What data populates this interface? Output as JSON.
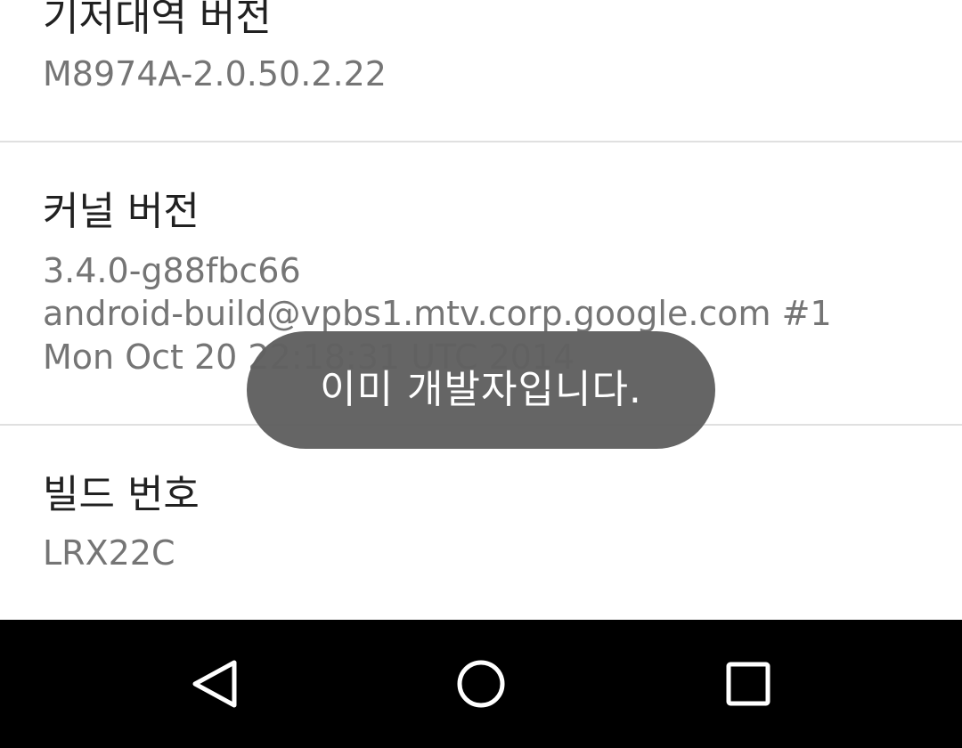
{
  "settings": {
    "baseband": {
      "title": "기저대역 버전",
      "summary": "M8974A-2.0.50.2.22"
    },
    "kernel": {
      "title": "커널 버전",
      "summary_lines": [
        "3.4.0-g88fbc66",
        "android-build@vpbs1.mtv.corp.google.com #1",
        "Mon Oct 20 22:18:31 UTC 2014"
      ]
    },
    "build": {
      "title": "빌드 번호",
      "summary": "LRX22C"
    }
  },
  "toast": {
    "message": "이미 개발자입니다."
  },
  "navigation": {
    "buttons": [
      {
        "icon": "back-triangle-icon"
      },
      {
        "icon": "home-circle-icon"
      },
      {
        "icon": "recents-square-icon"
      }
    ]
  },
  "colors": {
    "title_text": "#212121",
    "summary_text": "#757575",
    "divider": "#e0e0e0",
    "toast_background": "#606060",
    "nav_bar": "#000000",
    "nav_icon": "#ffffff"
  }
}
